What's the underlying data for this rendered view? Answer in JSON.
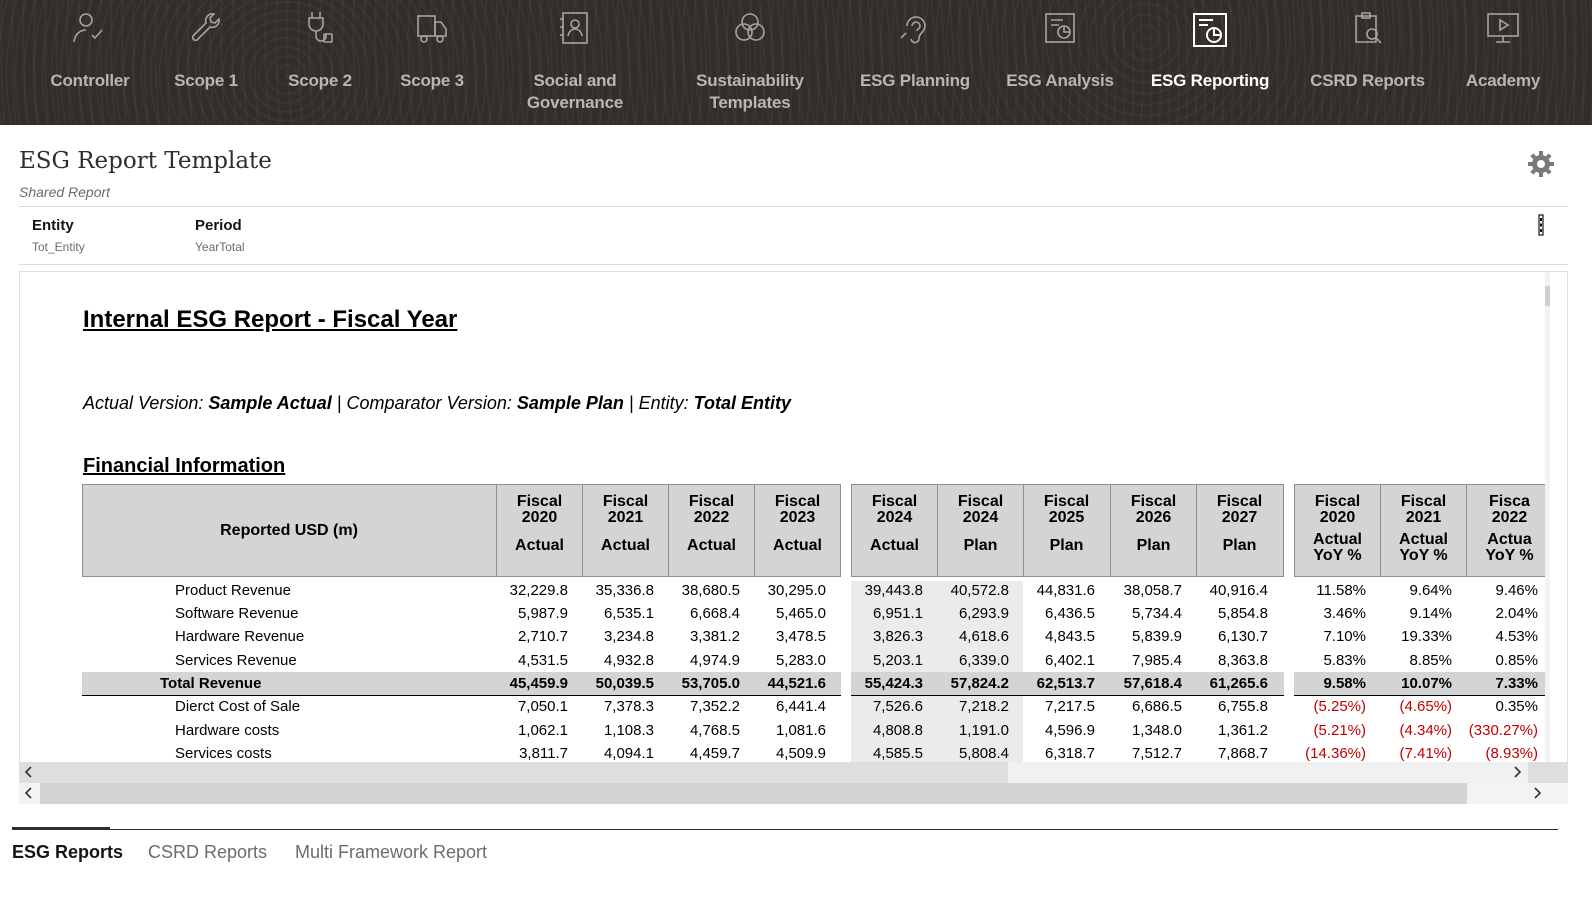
{
  "nav": {
    "items": [
      {
        "label": "Controller",
        "icon": "user-check-icon"
      },
      {
        "label": "Scope 1",
        "icon": "wrench-icon"
      },
      {
        "label": "Scope 2",
        "icon": "plug-icon"
      },
      {
        "label": "Scope 3",
        "icon": "truck-icon"
      },
      {
        "label": "Social and\nGovernance",
        "icon": "contact-book-icon"
      },
      {
        "label": "Sustainability\nTemplates",
        "icon": "venn-icon"
      },
      {
        "label": "ESG Planning",
        "icon": "ear-icon"
      },
      {
        "label": "ESG Analysis",
        "icon": "report-chart-icon"
      },
      {
        "label": "ESG Reporting",
        "icon": "report-pie-icon",
        "active": true
      },
      {
        "label": "CSRD Reports",
        "icon": "clipboard-search-icon"
      },
      {
        "label": "Academy",
        "icon": "monitor-play-icon"
      }
    ]
  },
  "header": {
    "title": "ESG Report Template",
    "subtitle": "Shared Report"
  },
  "pov": {
    "entity_label": "Entity",
    "entity_value": "Tot_Entity",
    "period_label": "Period",
    "period_value": "YearTotal"
  },
  "report": {
    "title": "Internal ESG Report - Fiscal Year",
    "versions": {
      "actual_prefix": "Actual Version: ",
      "actual_value": "Sample Actual",
      "comp_prefix": " | Comparator Version: ",
      "comp_value": "Sample Plan",
      "entity_prefix": " | Entity: ",
      "entity_value": "Total Entity"
    },
    "section": "Financial Information",
    "corner_label": "Reported USD (m)",
    "columns": [
      {
        "year": "Fiscal\n2020",
        "scenario": "Actual"
      },
      {
        "year": "Fiscal\n2021",
        "scenario": "Actual"
      },
      {
        "year": "Fiscal\n2022",
        "scenario": "Actual"
      },
      {
        "year": "Fiscal\n2023",
        "scenario": "Actual"
      },
      {
        "year": "Fiscal\n2024",
        "scenario": "Actual"
      },
      {
        "year": "Fiscal\n2024",
        "scenario": "Plan"
      },
      {
        "year": "Fiscal\n2025",
        "scenario": "Plan"
      },
      {
        "year": "Fiscal\n2026",
        "scenario": "Plan"
      },
      {
        "year": "Fiscal\n2027",
        "scenario": "Plan"
      },
      {
        "year": "Fiscal\n2020",
        "scenario": "Actual\nYoY %"
      },
      {
        "year": "Fiscal\n2021",
        "scenario": "Actual\nYoY %"
      },
      {
        "year": "Fisca\n2022",
        "scenario": "Actua\nYoY %"
      }
    ],
    "rows": [
      {
        "label": "Product Revenue",
        "cells": [
          "32,229.8",
          "35,336.8",
          "38,680.5",
          "30,295.0",
          "39,443.8",
          "40,572.8",
          "44,831.6",
          "38,058.7",
          "40,916.4",
          "11.58%",
          "9.64%",
          "9.46%"
        ]
      },
      {
        "label": "Software Revenue",
        "cells": [
          "5,987.9",
          "6,535.1",
          "6,668.4",
          "5,465.0",
          "6,951.1",
          "6,293.9",
          "6,436.5",
          "5,734.4",
          "5,854.8",
          "3.46%",
          "9.14%",
          "2.04%"
        ]
      },
      {
        "label": "Hardware Revenue",
        "cells": [
          "2,710.7",
          "3,234.8",
          "3,381.2",
          "3,478.5",
          "3,826.3",
          "4,618.6",
          "4,843.5",
          "5,839.9",
          "6,130.7",
          "7.10%",
          "19.33%",
          "4.53%"
        ]
      },
      {
        "label": "Services Revenue",
        "cells": [
          "4,531.5",
          "4,932.8",
          "4,974.9",
          "5,283.0",
          "5,203.1",
          "6,339.0",
          "6,402.1",
          "7,985.4",
          "8,363.8",
          "5.83%",
          "8.85%",
          "0.85%"
        ]
      },
      {
        "label": "Total Revenue",
        "total": true,
        "cells": [
          "45,459.9",
          "50,039.5",
          "53,705.0",
          "44,521.6",
          "55,424.3",
          "57,824.2",
          "62,513.7",
          "57,618.4",
          "61,265.6",
          "9.58%",
          "10.07%",
          "7.33%"
        ]
      },
      {
        "label": "Dierct Cost of Sale",
        "cells": [
          "7,050.1",
          "7,378.3",
          "7,352.2",
          "6,441.4",
          "7,526.6",
          "7,218.2",
          "7,217.5",
          "6,686.5",
          "6,755.8",
          "(5.25%)",
          "(4.65%)",
          "0.35%"
        ]
      },
      {
        "label": "Hardware costs",
        "cells": [
          "1,062.1",
          "1,108.3",
          "4,768.5",
          "1,081.6",
          "4,808.8",
          "1,191.0",
          "4,596.9",
          "1,348.0",
          "1,361.2",
          "(5.21%)",
          "(4.34%)",
          "(330.27%)"
        ]
      },
      {
        "label": "Services costs",
        "cells": [
          "3,811.7",
          "4,094.1",
          "4,459.7",
          "4,509.9",
          "4,585.5",
          "5,808.4",
          "6,318.7",
          "7,512.7",
          "7,868.7",
          "(14.36%)",
          "(7.41%)",
          "(8.93%)"
        ]
      }
    ]
  },
  "tabs": [
    {
      "label": "ESG Reports",
      "active": true
    },
    {
      "label": "CSRD Reports"
    },
    {
      "label": "Multi Framework Report"
    }
  ],
  "colors": {
    "nav_bg": "#312d2a",
    "negative": "#c00000",
    "header_grey": "#d4d4d4"
  }
}
